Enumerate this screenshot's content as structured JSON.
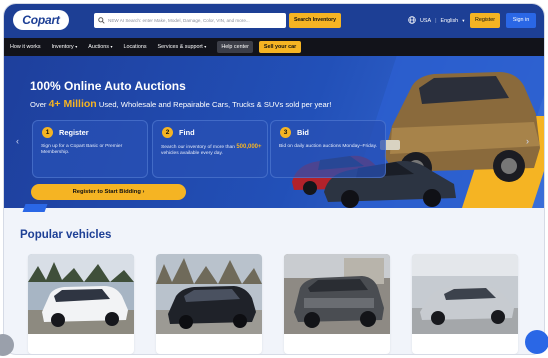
{
  "header": {
    "logo": "Copart",
    "search_placeholder": "NEW AI Search: enter Make, Model, Damage, Color, VIN, and more...",
    "search_button": "Search Inventory",
    "locale": "USA",
    "language": "English",
    "register": "Register",
    "sign_in": "Sign in"
  },
  "nav": {
    "items": [
      "How it works",
      "Inventory",
      "Auctions",
      "Locations",
      "Services & support",
      "Help center",
      "Sell your car"
    ]
  },
  "hero": {
    "title": "100% Online Auto Auctions",
    "sub_prefix": "Over ",
    "sub_highlight": "4+ Million",
    "sub_suffix": " Used, Wholesale and Repairable Cars, Trucks & SUVs sold per year!",
    "steps": [
      {
        "num": "1",
        "title": "Register",
        "desc": "Sign up for a Copart Basic or Premier Membership."
      },
      {
        "num": "2",
        "title": "Find",
        "desc_a": "Search our inventory of more than ",
        "desc_hi": "500,000+",
        "desc_b": " vehicles available every day."
      },
      {
        "num": "3",
        "title": "Bid",
        "desc": "Bid on daily auction auctions Monday–Friday."
      }
    ],
    "cta": "Register to Start Bidding ›",
    "prev": "‹",
    "next": "›"
  },
  "popular": {
    "title": "Popular vehicles"
  },
  "colors": {
    "brand_blue": "#1d3f95",
    "accent_yellow": "#f5b423",
    "sign_in_blue": "#2a67e6",
    "nav_bg": "#12131a"
  },
  "icons": [
    "search-icon",
    "globe-icon",
    "chevron-down-icon",
    "chevron-left-icon",
    "chevron-right-icon"
  ]
}
